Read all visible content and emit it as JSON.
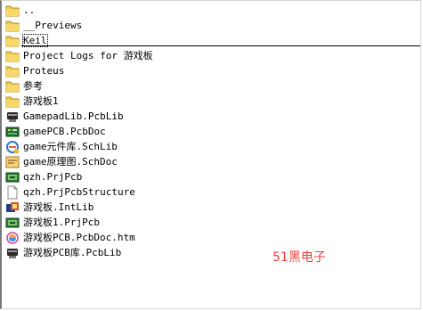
{
  "items": [
    {
      "label": "..",
      "icon": "folder-icon",
      "kind": "folder"
    },
    {
      "label": "__Previews",
      "icon": "folder-icon",
      "kind": "folder"
    },
    {
      "label": "Keil",
      "icon": "folder-icon",
      "kind": "folder"
    },
    {
      "label": "Project Logs for 游戏板",
      "icon": "folder-icon",
      "kind": "folder"
    },
    {
      "label": "Proteus",
      "icon": "folder-icon",
      "kind": "folder"
    },
    {
      "label": "参考",
      "icon": "folder-icon",
      "kind": "folder"
    },
    {
      "label": "游戏板1",
      "icon": "folder-icon",
      "kind": "folder"
    },
    {
      "label": "GamepadLib.PcbLib",
      "icon": "pcblib-icon",
      "kind": "file"
    },
    {
      "label": "gamePCB.PcbDoc",
      "icon": "pcbdoc-icon",
      "kind": "file"
    },
    {
      "label": "game元件库.SchLib",
      "icon": "schlib-icon",
      "kind": "file"
    },
    {
      "label": "game原理图.SchDoc",
      "icon": "schdoc-icon",
      "kind": "file"
    },
    {
      "label": "qzh.PrjPcb",
      "icon": "prjpcb-icon",
      "kind": "file"
    },
    {
      "label": "qzh.PrjPcbStructure",
      "icon": "blank-file-icon",
      "kind": "file"
    },
    {
      "label": "游戏板.IntLib",
      "icon": "intlib-icon",
      "kind": "file"
    },
    {
      "label": "游戏板1.PrjPcb",
      "icon": "prjpcb-icon",
      "kind": "file"
    },
    {
      "label": "游戏板PCB.PcbDoc.htm",
      "icon": "html-icon",
      "kind": "file"
    },
    {
      "label": "游戏板PCB库.PcbLib",
      "icon": "pcblib-icon",
      "kind": "file"
    }
  ],
  "focused_index": 2,
  "watermark": "51黑电子",
  "colors": {
    "folder": "#f0c040",
    "watermark": "#e8413a"
  }
}
